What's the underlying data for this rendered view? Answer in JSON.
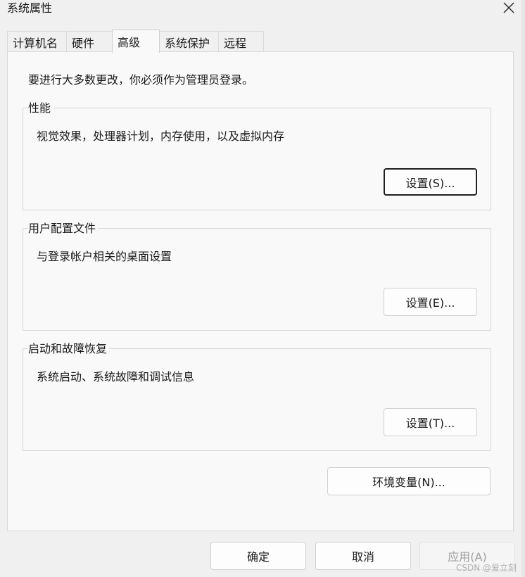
{
  "window": {
    "title": "系统属性",
    "close_icon": "close-icon"
  },
  "tabs": [
    {
      "label": "计算机名"
    },
    {
      "label": "硬件"
    },
    {
      "label": "高级",
      "active": true
    },
    {
      "label": "系统保护"
    },
    {
      "label": "远程"
    }
  ],
  "advanced": {
    "admin_note": "要进行大多数更改，你必须作为管理员登录。",
    "performance": {
      "label": "性能",
      "description": "视觉效果，处理器计划，内存使用，以及虚拟内存",
      "button": "设置(S)..."
    },
    "user_profiles": {
      "label": "用户配置文件",
      "description": "与登录帐户相关的桌面设置",
      "button": "设置(E)..."
    },
    "startup_recovery": {
      "label": "启动和故障恢复",
      "description": "系统启动、系统故障和调试信息",
      "button": "设置(T)..."
    },
    "env_button": "环境变量(N)..."
  },
  "footer": {
    "ok": "确定",
    "cancel": "取消",
    "apply": "应用(A)"
  },
  "watermark": "CSDN @爱立刻",
  "colors": {
    "window_bg": "#f0f0f0",
    "panel_bg": "#f9f9f9",
    "border": "#d6d6d6",
    "focus_border": "#1f1f1f"
  }
}
